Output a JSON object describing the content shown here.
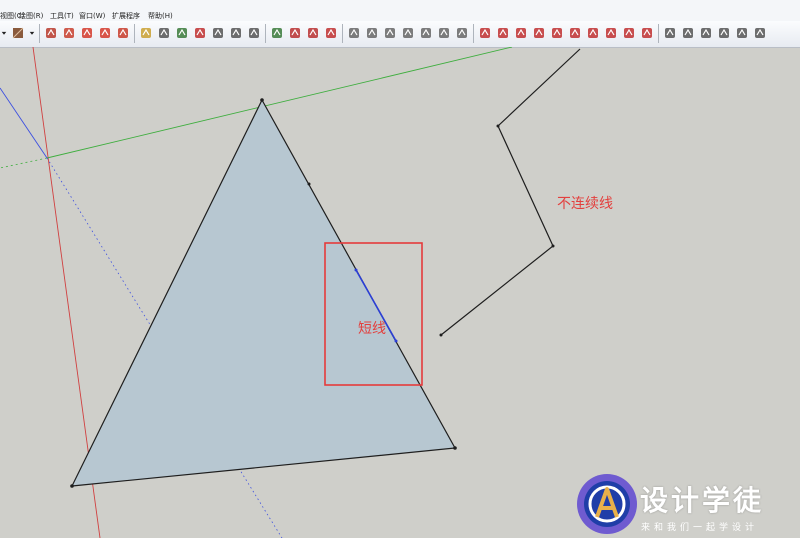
{
  "menubar": {
    "items": [
      {
        "label": "视图(C)"
      },
      {
        "label": "绘图(R)"
      },
      {
        "label": "工具(T)"
      },
      {
        "label": "窗口(W)"
      },
      {
        "label": "扩展程序"
      },
      {
        "label": "帮助(H)"
      }
    ]
  },
  "toolbar": {
    "tools": [
      {
        "name": "dropdown-arrow-icon",
        "color": "#222222"
      },
      {
        "name": "material-swatch-icon",
        "color": "#8a5a3c"
      },
      {
        "name": "dropdown-arrow-icon",
        "color": "#222222"
      },
      {
        "name": "push-pull-icon",
        "color": "#b83a2c"
      },
      {
        "name": "follow-me-icon",
        "color": "#c8402e"
      },
      {
        "name": "move-icon",
        "color": "#d43a2c"
      },
      {
        "name": "rotate-icon",
        "color": "#d43a2c"
      },
      {
        "name": "scale-icon",
        "color": "#c83c2c"
      },
      {
        "name": "tape-measure-icon",
        "color": "#c9a030"
      },
      {
        "name": "dimension-icon",
        "color": "#555555"
      },
      {
        "name": "paint-bucket-icon",
        "color": "#3a7a3a"
      },
      {
        "name": "orbit-icon",
        "color": "#c03030"
      },
      {
        "name": "pan-icon",
        "color": "#555555"
      },
      {
        "name": "zoom-icon",
        "color": "#555555"
      },
      {
        "name": "zoom-extents-icon",
        "color": "#555555"
      },
      {
        "name": "section-plane-icon",
        "color": "#3a7a3a"
      },
      {
        "name": "components-icon",
        "color": "#b83030"
      },
      {
        "name": "warehouse-icon",
        "color": "#b83030"
      },
      {
        "name": "share-model-icon",
        "color": "#c03030"
      },
      {
        "name": "style-icon",
        "color": "#666666"
      },
      {
        "name": "x-ray-icon",
        "color": "#666666"
      },
      {
        "name": "wireframe-icon",
        "color": "#666666"
      },
      {
        "name": "hidden-line-icon",
        "color": "#666666"
      },
      {
        "name": "shaded-icon",
        "color": "#666666"
      },
      {
        "name": "textured-icon",
        "color": "#666666"
      },
      {
        "name": "monochrome-icon",
        "color": "#666666"
      },
      {
        "name": "line-tool-icon",
        "color": "#c03030"
      },
      {
        "name": "arc-icon",
        "color": "#c03030"
      },
      {
        "name": "freehand-icon",
        "color": "#c03030"
      },
      {
        "name": "polygon-icon",
        "color": "#c03030"
      },
      {
        "name": "rectangle-icon",
        "color": "#c03030"
      },
      {
        "name": "weld-icon",
        "color": "#c03030"
      },
      {
        "name": "offset-icon",
        "color": "#c03030"
      },
      {
        "name": "split-icon",
        "color": "#c03030"
      },
      {
        "name": "close-gap-icon",
        "color": "#c03030"
      },
      {
        "name": "face-icon",
        "color": "#c03030"
      },
      {
        "name": "sandbox-icon",
        "color": "#555555"
      },
      {
        "name": "extrude-icon",
        "color": "#555555"
      },
      {
        "name": "bend-icon",
        "color": "#555555"
      },
      {
        "name": "solid-icon",
        "color": "#555555"
      },
      {
        "name": "inspector-icon",
        "color": "#555555"
      },
      {
        "name": "overflow-icon",
        "color": "#555555"
      }
    ]
  },
  "canvas": {
    "labels": {
      "discontinuous": "不连续线",
      "short_line": "短线"
    },
    "colors": {
      "background": "#cfcfca",
      "face": "#b7c7d1",
      "edge": "#1e1e1e",
      "highlight_box": "#e53b3b",
      "highlight_edge": "#2b3fd6",
      "axis_red": "#d04040",
      "axis_green": "#3fae3f",
      "axis_blue": "#3c4fe0"
    }
  },
  "logo": {
    "title": "设计学徒",
    "slogan": "来和我们一起学设计",
    "colors": {
      "ring": "#6f5bd0",
      "inner": "#1f3ea8",
      "letter": "#e8b04a"
    }
  }
}
